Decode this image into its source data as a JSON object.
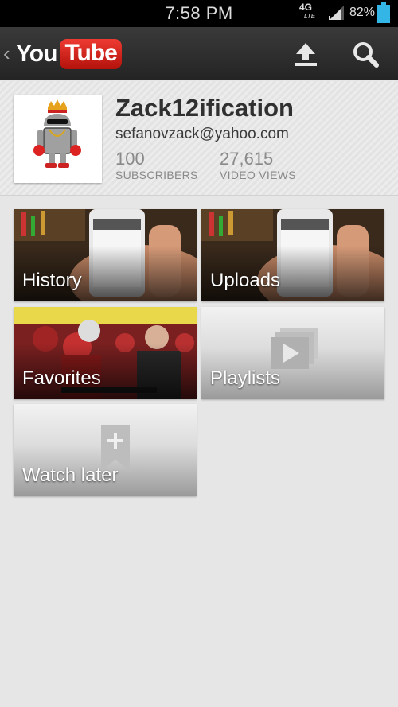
{
  "status_bar": {
    "time": "7:58 PM",
    "network": "4G",
    "network_sub": "LTE",
    "battery_percent": "82%",
    "battery_level": 0.82
  },
  "action_bar": {
    "logo_you": "You",
    "logo_tube": "Tube",
    "icons": [
      "back-chevron-icon",
      "upload-icon",
      "search-icon"
    ]
  },
  "profile": {
    "username": "Zack12ification",
    "email": "sefanovzack@yahoo.com",
    "subscribers_count": "100",
    "subscribers_label": "SUBSCRIBERS",
    "views_count": "27,615",
    "views_label": "VIDEO VIEWS"
  },
  "tiles": [
    {
      "label": "History"
    },
    {
      "label": "Uploads"
    },
    {
      "label": "Favorites"
    },
    {
      "label": "Playlists"
    },
    {
      "label": "Watch later"
    }
  ],
  "colors": {
    "brand_red": "#e62117",
    "background": "#e6e6e6",
    "action_bar": "#2e2e2e",
    "battery": "#33b5e5"
  }
}
